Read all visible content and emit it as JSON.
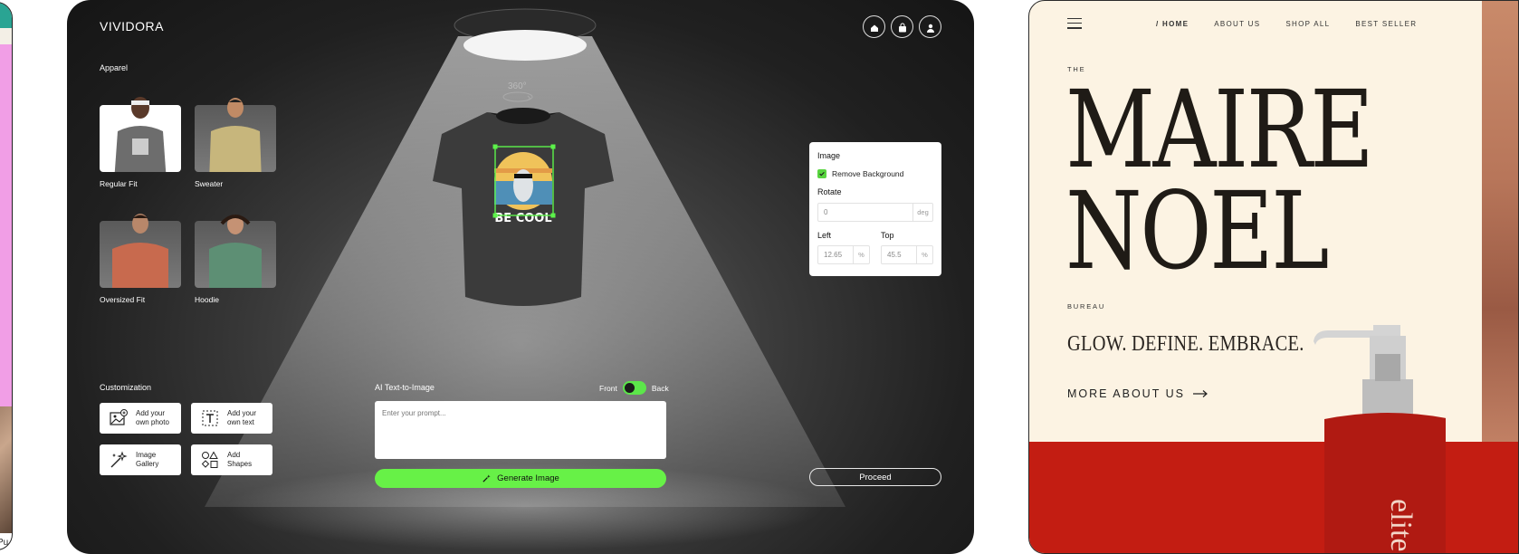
{
  "left_card": {
    "partial_text": "Pu"
  },
  "app": {
    "brand": "VIVIDORA",
    "top_icons": [
      "home-icon",
      "bag-icon",
      "user-icon"
    ],
    "rotate_badge": "360°",
    "apparel": {
      "title": "Apparel",
      "items": [
        {
          "label": "Regular Fit",
          "color": "#6b6b6b"
        },
        {
          "label": "Sweater",
          "color": "#c5b57a"
        },
        {
          "label": "Oversized Fit",
          "color": "#c86a4e"
        },
        {
          "label": "Hoodie",
          "color": "#5d8f74"
        }
      ]
    },
    "customization": {
      "title": "Customization",
      "items": [
        {
          "label": "Add your\nown photo",
          "icon": "add-photo-icon"
        },
        {
          "label": "Add your\nown text",
          "icon": "add-text-icon"
        },
        {
          "label": "Image\nGallery",
          "icon": "image-gallery-icon"
        },
        {
          "label": "Add\nShapes",
          "icon": "shapes-icon"
        }
      ]
    },
    "tshirt": {
      "print_text": "BE COOL",
      "shirt_color": "#3a3a3a",
      "handle_color": "#5cf24a"
    },
    "ai": {
      "title": "AI Text-to-Image",
      "front_label": "Front",
      "back_label": "Back",
      "toggle_on": true,
      "prompt_placeholder": "Enter your prompt...",
      "generate_label": "Generate Image"
    },
    "image_panel": {
      "title": "Image",
      "remove_bg_label": "Remove Background",
      "remove_bg_checked": true,
      "rotate_label": "Rotate",
      "rotate_value": "0",
      "rotate_unit": "deg",
      "left_label": "Left",
      "left_value": "12.65",
      "left_unit": "%",
      "top_label": "Top",
      "top_value": "45.5",
      "top_unit": "%"
    },
    "proceed_label": "Proceed",
    "accent": "#67f147"
  },
  "right_card": {
    "nav": [
      "/ HOME",
      "ABOUT US",
      "SHOP ALL",
      "BEST SELLER"
    ],
    "the_label": "THE",
    "hero_line1": "MAIRE",
    "hero_line2": "NOEL",
    "bureau_label": "BUREAU",
    "tagline": "GLOW. DEFINE. EMBRACE.",
    "cta": "MORE ABOUT US",
    "bottle_text": "elite",
    "bg_color": "#fcf3e3",
    "red_color": "#c31d12"
  }
}
